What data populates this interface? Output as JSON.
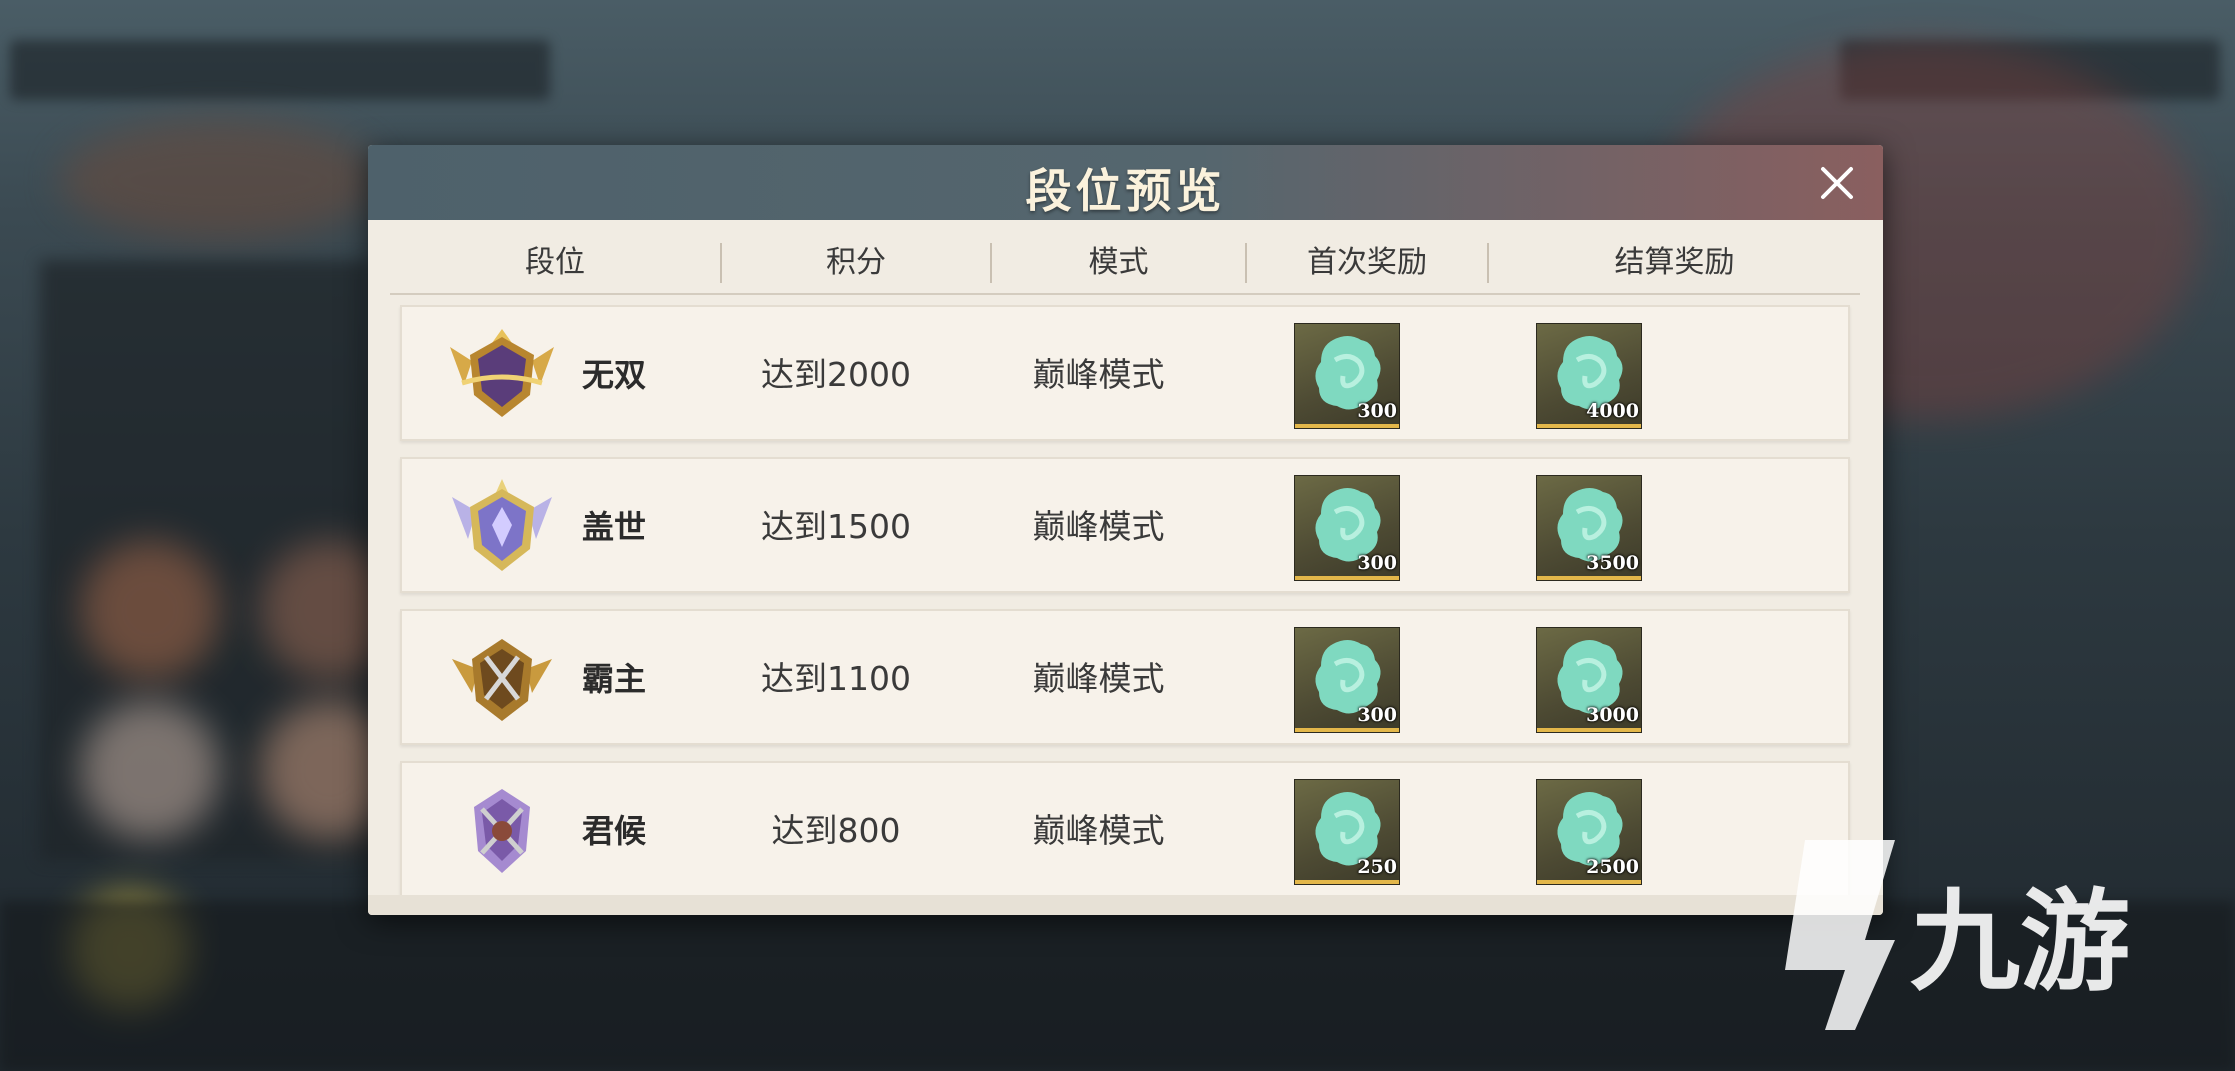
{
  "modal": {
    "title": "段位预览",
    "columns": [
      "段位",
      "积分",
      "模式",
      "首次奖励",
      "结算奖励"
    ]
  },
  "rows": [
    {
      "rank": "无双",
      "points": "达到2000",
      "mode": "巅峰模式",
      "first_reward": "300",
      "settle_reward": "4000",
      "icon": "rank-wushuang-icon",
      "color": "#5a3d7a"
    },
    {
      "rank": "盖世",
      "points": "达到1500",
      "mode": "巅峰模式",
      "first_reward": "300",
      "settle_reward": "3500",
      "icon": "rank-gaishi-icon",
      "color": "#7d74c8"
    },
    {
      "rank": "霸主",
      "points": "达到1100",
      "mode": "巅峰模式",
      "first_reward": "300",
      "settle_reward": "3000",
      "icon": "rank-bazhu-icon",
      "color": "#b3893a"
    },
    {
      "rank": "君候",
      "points": "达到800",
      "mode": "巅峰模式",
      "first_reward": "250",
      "settle_reward": "2500",
      "icon": "rank-junhou-icon",
      "color": "#7a5aa8"
    }
  ],
  "reward_icon": "jade-icon",
  "watermark": "九游",
  "colors": {
    "header_bg": "#55666e",
    "panel_bg": "#f1ece3",
    "reward_accent": "#e3b74a",
    "jade": "#7fd9c0"
  }
}
